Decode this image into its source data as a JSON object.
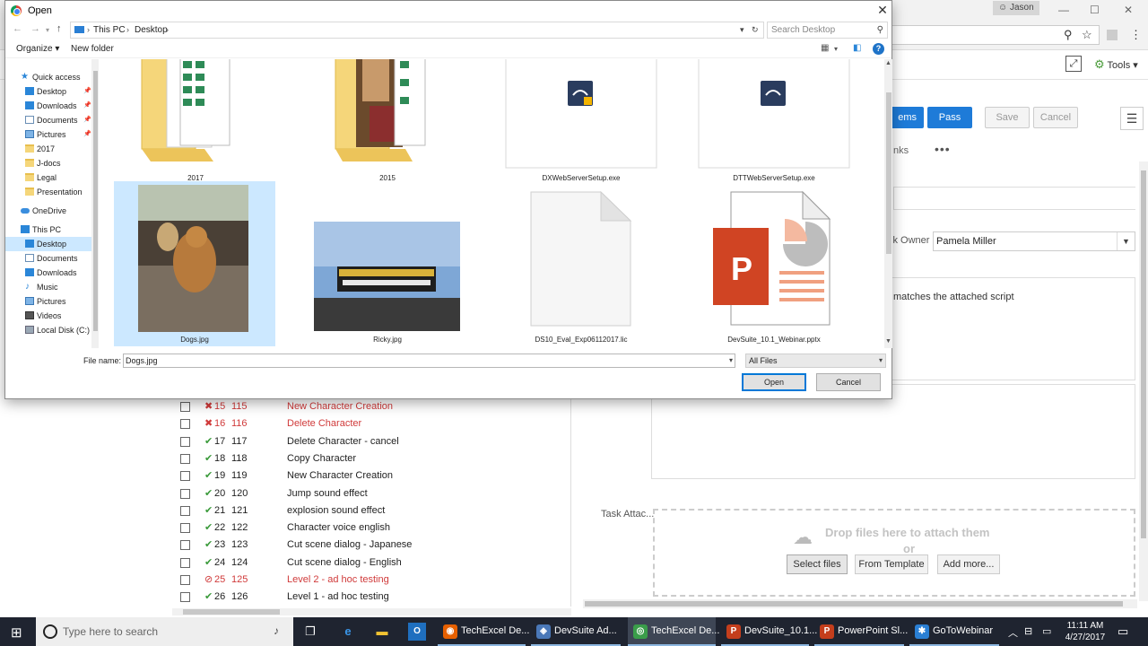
{
  "background": {
    "user_name": "Jason",
    "tools_label": "Tools",
    "buttons": {
      "items_label": "ems",
      "pass_label": "Pass",
      "save_label": "Save",
      "cancel_label": "Cancel"
    },
    "tab_fragment": "nks",
    "tab_more": "•••",
    "task_owner_label": "sk Owner",
    "task_owner_value": "Pamela Miller",
    "description_text": "matches the attached script",
    "attachments": {
      "label": "Task Attac...",
      "drop_title": "Drop files here to attach them",
      "drop_or": "or",
      "select_files": "Select files",
      "from_template": "From Template",
      "add_more": "Add more..."
    },
    "test_list": [
      {
        "num": "15",
        "id": "115",
        "name": "New Character Creation",
        "status": "fail",
        "red": true
      },
      {
        "num": "16",
        "id": "116",
        "name": "Delete Character",
        "status": "fail",
        "red": true
      },
      {
        "num": "17",
        "id": "117",
        "name": "Delete Character - cancel",
        "status": "pass",
        "red": false
      },
      {
        "num": "18",
        "id": "118",
        "name": "Copy Character",
        "status": "pass",
        "red": false
      },
      {
        "num": "19",
        "id": "119",
        "name": "New Character Creation",
        "status": "pass",
        "red": false
      },
      {
        "num": "20",
        "id": "120",
        "name": "Jump sound effect",
        "status": "pass",
        "red": false
      },
      {
        "num": "21",
        "id": "121",
        "name": "explosion sound effect",
        "status": "pass",
        "red": false
      },
      {
        "num": "22",
        "id": "122",
        "name": "Character voice english",
        "status": "pass",
        "red": false
      },
      {
        "num": "23",
        "id": "123",
        "name": "Cut scene dialog - Japanese",
        "status": "pass",
        "red": false
      },
      {
        "num": "24",
        "id": "124",
        "name": "Cut scene dialog - English",
        "status": "pass",
        "red": false
      },
      {
        "num": "25",
        "id": "125",
        "name": "Level 2 - ad hoc testing",
        "status": "blocked",
        "red": true
      },
      {
        "num": "26",
        "id": "126",
        "name": "Level 1 - ad hoc testing",
        "status": "pass",
        "red": false
      }
    ]
  },
  "dialog": {
    "title": "Open",
    "breadcrumb": [
      "This PC",
      "Desktop"
    ],
    "search_placeholder": "Search Desktop",
    "organize_label": "Organize",
    "new_folder_label": "New folder",
    "nav_items": [
      {
        "label": "Quick access",
        "icon": "star-icon",
        "pinned": false,
        "indent": 0
      },
      {
        "label": "Desktop",
        "icon": "desktop-icon",
        "pinned": true,
        "indent": 1
      },
      {
        "label": "Downloads",
        "icon": "downloads-icon",
        "pinned": true,
        "indent": 1
      },
      {
        "label": "Documents",
        "icon": "documents-icon",
        "pinned": true,
        "indent": 1
      },
      {
        "label": "Pictures",
        "icon": "pictures-icon",
        "pinned": true,
        "indent": 1
      },
      {
        "label": "2017",
        "icon": "folder-icon",
        "pinned": false,
        "indent": 1
      },
      {
        "label": "J-docs",
        "icon": "folder-icon",
        "pinned": false,
        "indent": 1
      },
      {
        "label": "Legal",
        "icon": "folder-icon",
        "pinned": false,
        "indent": 1
      },
      {
        "label": "Presentation",
        "icon": "folder-icon",
        "pinned": false,
        "indent": 1
      },
      {
        "label": "OneDrive",
        "icon": "onedrive-icon",
        "pinned": false,
        "indent": 0
      },
      {
        "label": "This PC",
        "icon": "pc-icon",
        "pinned": false,
        "indent": 0
      },
      {
        "label": "Desktop",
        "icon": "desktop-icon",
        "pinned": false,
        "indent": 1,
        "selected": true
      },
      {
        "label": "Documents",
        "icon": "documents-icon",
        "pinned": false,
        "indent": 1
      },
      {
        "label": "Downloads",
        "icon": "downloads-icon",
        "pinned": false,
        "indent": 1
      },
      {
        "label": "Music",
        "icon": "music-icon",
        "pinned": false,
        "indent": 1
      },
      {
        "label": "Pictures",
        "icon": "pictures-icon",
        "pinned": false,
        "indent": 1
      },
      {
        "label": "Videos",
        "icon": "videos-icon",
        "pinned": false,
        "indent": 1
      },
      {
        "label": "Local Disk (C:)",
        "icon": "disk-icon",
        "pinned": false,
        "indent": 1
      }
    ],
    "files": [
      {
        "name": "2017",
        "kind": "folder"
      },
      {
        "name": "2015",
        "kind": "folder"
      },
      {
        "name": "DXWebServerSetup.exe",
        "kind": "exe"
      },
      {
        "name": "DTTWebServerSetup.exe",
        "kind": "exe"
      },
      {
        "name": "Dogs.jpg",
        "kind": "photo-dogs",
        "selected": true
      },
      {
        "name": "Ricky.jpg",
        "kind": "photo-stadium"
      },
      {
        "name": "DS10_Eval_Exp06112017.lic",
        "kind": "blank"
      },
      {
        "name": "DevSuite_10.1_Webinar.pptx",
        "kind": "pptx"
      }
    ],
    "file_name_label": "File name:",
    "file_name_value": "Dogs.jpg",
    "file_type_value": "All Files",
    "open_label": "Open",
    "cancel_label": "Cancel"
  },
  "taskbar": {
    "search_placeholder": "Type here to search",
    "apps": [
      {
        "label": "TechExcel De...",
        "icon": "firefox-icon",
        "color": "#e66000"
      },
      {
        "label": "DevSuite Ad...",
        "icon": "devsuite-icon",
        "color": "#4a78b8"
      },
      {
        "label": "TechExcel De...",
        "icon": "chrome-icon",
        "color": "#3a9d4a",
        "active": true
      },
      {
        "label": "DevSuite_10.1...",
        "icon": "powerpoint-icon",
        "color": "#c43e1c"
      },
      {
        "label": "PowerPoint Sl...",
        "icon": "powerpoint-icon",
        "color": "#c43e1c"
      },
      {
        "label": "GoToWebinar",
        "icon": "gotowebinar-icon",
        "color": "#2a7fd4"
      }
    ],
    "time": "11:11 AM",
    "date": "4/27/2017"
  }
}
